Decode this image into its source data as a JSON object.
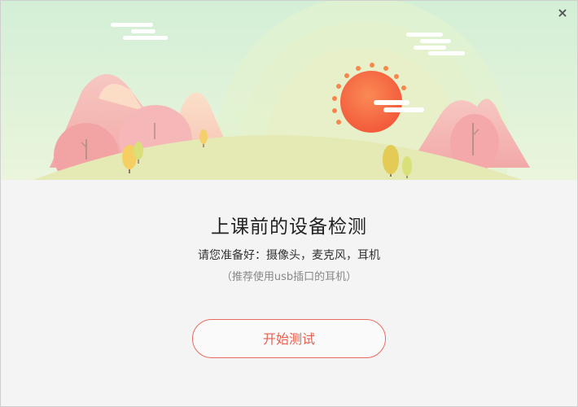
{
  "dialog": {
    "close_label": "×",
    "title": "上课前的设备检测",
    "subtitle": "请您准备好：摄像头，麦克风，耳机",
    "note": "（推荐使用usb插口的耳机）",
    "start_button": "开始测试"
  },
  "colors": {
    "accent": "#e8604f",
    "banner_sky": "#d7efd8",
    "sun": "#f46c45",
    "hill": "#e6eab4",
    "mountain": "#f4b9b5"
  }
}
